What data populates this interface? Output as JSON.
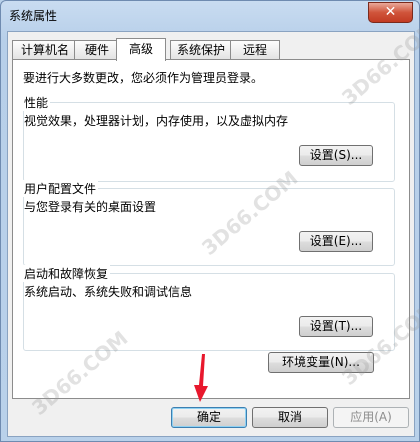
{
  "window": {
    "title": "系统属性",
    "close_label": "✕"
  },
  "tabs": [
    {
      "label": "计算机名",
      "active": false
    },
    {
      "label": "硬件",
      "active": false
    },
    {
      "label": "高级",
      "active": true
    },
    {
      "label": "系统保护",
      "active": false
    },
    {
      "label": "远程",
      "active": false
    }
  ],
  "advanced": {
    "admin_note": "要进行大多数更改，您必须作为管理员登录。",
    "performance": {
      "title": "性能",
      "description": "视觉效果，处理器计划，内存使用，以及虚拟内存",
      "button": "设置(S)..."
    },
    "user_profiles": {
      "title": "用户配置文件",
      "description": "与您登录有关的桌面设置",
      "button": "设置(E)..."
    },
    "startup_recovery": {
      "title": "启动和故障恢复",
      "description": "系统启动、系统失败和调试信息",
      "button": "设置(T)..."
    },
    "env_vars_button": "环境变量(N)..."
  },
  "footer": {
    "ok": "确定",
    "cancel": "取消",
    "apply": "应用(A)"
  },
  "watermark_text": "3D66.COM",
  "colors": {
    "arrow": "#e8182d",
    "titlebar": "#c9dcf1",
    "close": "#c23b23"
  }
}
